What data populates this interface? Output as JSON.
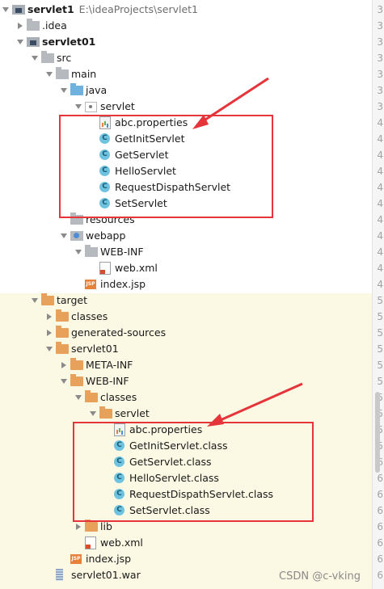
{
  "tree": [
    {
      "label": "servlet1",
      "path": "E:\\ideaProjects\\servlet1",
      "bold": true,
      "icon": "module-icon",
      "arrow": "open",
      "depth": 0
    },
    {
      "label": ".idea",
      "icon": "folder-gray-icon",
      "arrow": "closed",
      "depth": 1
    },
    {
      "label": "servlet01",
      "bold": true,
      "icon": "module-icon",
      "arrow": "open",
      "depth": 1
    },
    {
      "label": "src",
      "icon": "folder-gray-icon",
      "arrow": "open",
      "depth": 2
    },
    {
      "label": "main",
      "icon": "folder-gray-icon",
      "arrow": "open",
      "depth": 3
    },
    {
      "label": "java",
      "icon": "folder-blue-icon",
      "arrow": "open",
      "depth": 4
    },
    {
      "label": "servlet",
      "icon": "package-icon",
      "arrow": "open",
      "depth": 5
    },
    {
      "label": "abc.properties",
      "icon": "properties-file-icon",
      "arrow": "none",
      "depth": 6
    },
    {
      "label": "GetInitServlet",
      "icon": "class-icon",
      "arrow": "none",
      "depth": 6
    },
    {
      "label": "GetServlet",
      "icon": "class-icon",
      "arrow": "none",
      "depth": 6
    },
    {
      "label": "HelloServlet",
      "icon": "class-icon",
      "arrow": "none",
      "depth": 6
    },
    {
      "label": "RequestDispathServlet",
      "icon": "class-icon",
      "arrow": "none",
      "depth": 6
    },
    {
      "label": "SetServlet",
      "icon": "class-icon",
      "arrow": "none",
      "depth": 6
    },
    {
      "label": "resources",
      "icon": "folder-gray-icon",
      "arrow": "none",
      "depth": 4
    },
    {
      "label": "webapp",
      "icon": "webapp-folder-icon",
      "arrow": "open",
      "depth": 4
    },
    {
      "label": "WEB-INF",
      "icon": "folder-gray-icon",
      "arrow": "open",
      "depth": 5
    },
    {
      "label": "web.xml",
      "icon": "xml-file-icon",
      "arrow": "none",
      "depth": 6
    },
    {
      "label": "index.jsp",
      "icon": "jsp-file-icon",
      "arrow": "none",
      "depth": 5
    },
    {
      "label": "target",
      "icon": "folder-orange-icon",
      "arrow": "open",
      "depth": 2
    },
    {
      "label": "classes",
      "icon": "folder-orange-icon",
      "arrow": "closed",
      "depth": 3
    },
    {
      "label": "generated-sources",
      "icon": "folder-orange-icon",
      "arrow": "closed",
      "depth": 3
    },
    {
      "label": "servlet01",
      "icon": "folder-orange-icon",
      "arrow": "open",
      "depth": 3
    },
    {
      "label": "META-INF",
      "icon": "folder-orange-icon",
      "arrow": "closed",
      "depth": 4
    },
    {
      "label": "WEB-INF",
      "icon": "folder-orange-icon",
      "arrow": "open",
      "depth": 4
    },
    {
      "label": "classes",
      "icon": "folder-orange-icon",
      "arrow": "open",
      "depth": 5
    },
    {
      "label": "servlet",
      "icon": "folder-orange-icon",
      "arrow": "open",
      "depth": 6
    },
    {
      "label": "abc.properties",
      "icon": "properties-file-icon",
      "arrow": "none",
      "depth": 7
    },
    {
      "label": "GetInitServlet.class",
      "icon": "class-icon",
      "arrow": "none",
      "depth": 7
    },
    {
      "label": "GetServlet.class",
      "icon": "class-icon",
      "arrow": "none",
      "depth": 7
    },
    {
      "label": "HelloServlet.class",
      "icon": "class-icon",
      "arrow": "none",
      "depth": 7
    },
    {
      "label": "RequestDispathServlet.class",
      "icon": "class-icon",
      "arrow": "none",
      "depth": 7
    },
    {
      "label": "SetServlet.class",
      "icon": "class-icon",
      "arrow": "none",
      "depth": 7
    },
    {
      "label": "lib",
      "icon": "folder-orange-icon",
      "arrow": "closed",
      "depth": 5
    },
    {
      "label": "web.xml",
      "icon": "xml-file-icon",
      "arrow": "none",
      "depth": 5
    },
    {
      "label": "index.jsp",
      "icon": "jsp-file-icon",
      "arrow": "none",
      "depth": 4
    },
    {
      "label": "servlet01.war",
      "icon": "war-file-icon",
      "arrow": "none",
      "depth": 3
    }
  ],
  "gutter_numbers": [
    "3",
    "3",
    "3",
    "3",
    "3",
    "3",
    "3",
    "4",
    "4",
    "4",
    "4",
    "4",
    "4",
    "4",
    "4",
    "4",
    "4",
    "4",
    "5",
    "5",
    "5",
    "5",
    "5",
    "5",
    "5",
    "5",
    "5",
    "5",
    "6",
    "6",
    "6",
    "6",
    "6",
    "6",
    "6",
    "6"
  ],
  "colors": {
    "highlight_red": "#e5343a",
    "target_background": "#fbf8e3"
  },
  "icons": {
    "class_letter": "C",
    "jsp_text": "JSP"
  },
  "watermark": "CSDN @c-vking"
}
